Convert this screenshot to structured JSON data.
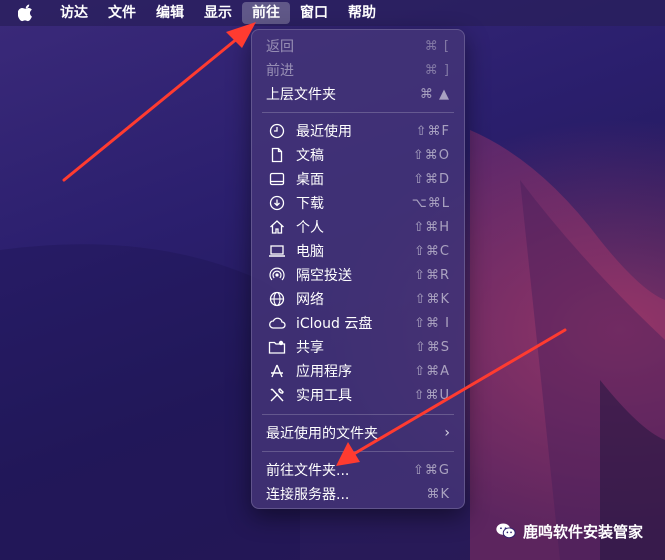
{
  "menubar": {
    "items": [
      "访达",
      "文件",
      "编辑",
      "显示",
      "前往",
      "窗口",
      "帮助"
    ],
    "active_index": 4
  },
  "menu": {
    "top_items": [
      {
        "label": "返回",
        "shortcut": "⌘ [",
        "enabled": false
      },
      {
        "label": "前进",
        "shortcut": "⌘ ]",
        "enabled": false
      },
      {
        "label": "上层文件夹",
        "shortcut": "⌘ ▲",
        "enabled": true
      }
    ],
    "places": [
      {
        "label": "最近使用",
        "shortcut": "⇧⌘F",
        "icon": "clock-icon"
      },
      {
        "label": "文稿",
        "shortcut": "⇧⌘O",
        "icon": "document-icon"
      },
      {
        "label": "桌面",
        "shortcut": "⇧⌘D",
        "icon": "desktop-icon"
      },
      {
        "label": "下载",
        "shortcut": "⌥⌘L",
        "icon": "download-icon"
      },
      {
        "label": "个人",
        "shortcut": "⇧⌘H",
        "icon": "home-icon"
      },
      {
        "label": "电脑",
        "shortcut": "⇧⌘C",
        "icon": "laptop-icon"
      },
      {
        "label": "隔空投送",
        "shortcut": "⇧⌘R",
        "icon": "airdrop-icon"
      },
      {
        "label": "网络",
        "shortcut": "⇧⌘K",
        "icon": "globe-icon"
      },
      {
        "label": "iCloud 云盘",
        "shortcut": "⇧⌘ I",
        "icon": "cloud-icon"
      },
      {
        "label": "共享",
        "shortcut": "⇧⌘S",
        "icon": "shared-folder-icon"
      },
      {
        "label": "应用程序",
        "shortcut": "⇧⌘A",
        "icon": "applications-icon"
      },
      {
        "label": "实用工具",
        "shortcut": "⇧⌘U",
        "icon": "utilities-icon"
      }
    ],
    "recent_folders": "最近使用的文件夹",
    "goto_folder": {
      "label": "前往文件夹...",
      "shortcut": "⇧⌘G"
    },
    "connect_server": {
      "label": "连接服务器...",
      "shortcut": "⌘K"
    }
  },
  "watermark": "鹿鸣软件安装管家",
  "colors": {
    "arrow": "#ff3b30",
    "menu_bg": "#44347a"
  }
}
